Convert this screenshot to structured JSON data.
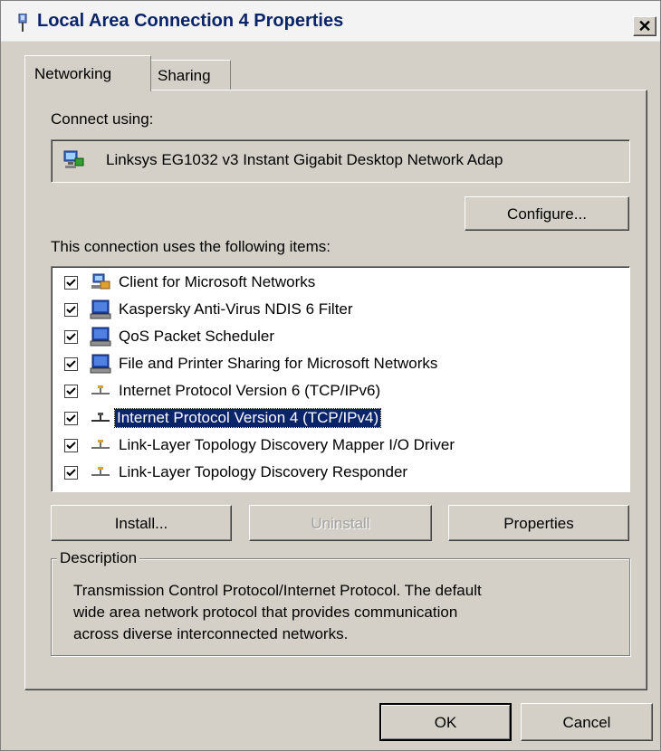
{
  "window": {
    "title": "Local Area Connection 4 Properties",
    "close_glyph": "✕"
  },
  "tabs": [
    {
      "label": "Networking",
      "active": true
    },
    {
      "label": "Sharing",
      "active": false
    }
  ],
  "connect_using": {
    "label": "Connect using:",
    "adapter": "Linksys EG1032 v3 Instant Gigabit Desktop Network Adap",
    "adapter_icon": "network-adapter-icon"
  },
  "configure_button": "Configure...",
  "items_label": "This connection uses the following items:",
  "items": [
    {
      "label": "Client for Microsoft Networks",
      "checked": true,
      "icon": "client-network-icon",
      "selected": false
    },
    {
      "label": "Kaspersky Anti-Virus NDIS 6 Filter",
      "checked": true,
      "icon": "service-computer-icon",
      "selected": false
    },
    {
      "label": "QoS Packet Scheduler",
      "checked": true,
      "icon": "service-computer-icon",
      "selected": false
    },
    {
      "label": "File and Printer Sharing for Microsoft Networks",
      "checked": true,
      "icon": "service-computer-icon",
      "selected": false
    },
    {
      "label": "Internet Protocol Version 6 (TCP/IPv6)",
      "checked": true,
      "icon": "protocol-icon",
      "selected": false
    },
    {
      "label": "Internet Protocol Version 4 (TCP/IPv4)",
      "checked": true,
      "icon": "protocol-icon",
      "selected": true
    },
    {
      "label": "Link-Layer Topology Discovery Mapper I/O Driver",
      "checked": true,
      "icon": "protocol-icon",
      "selected": false
    },
    {
      "label": "Link-Layer Topology Discovery Responder",
      "checked": true,
      "icon": "protocol-icon",
      "selected": false
    }
  ],
  "buttons": {
    "install": "Install...",
    "uninstall": "Uninstall",
    "properties": "Properties"
  },
  "description": {
    "legend": "Description",
    "line1": "Transmission Control Protocol/Internet Protocol. The default",
    "line2": "wide area network protocol that provides communication",
    "line3": "across diverse interconnected networks."
  },
  "footer": {
    "ok": "OK",
    "cancel": "Cancel"
  },
  "colors": {
    "face": "#d4d0c8",
    "selection": "#0a246a",
    "title_text": "#0a246a"
  }
}
